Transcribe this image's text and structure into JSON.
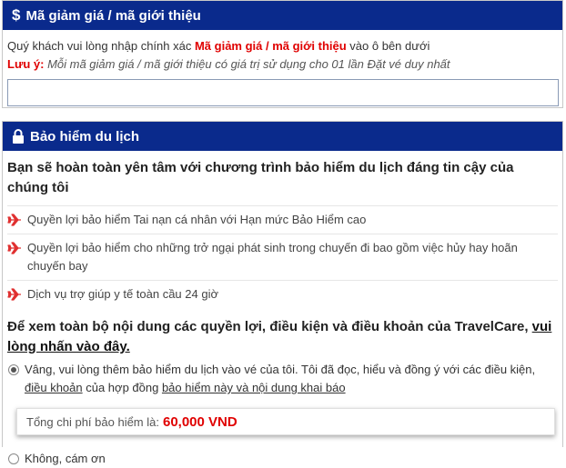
{
  "promo": {
    "title": "Mã giảm giá / mã giới thiệu",
    "icon": "dollar-icon",
    "instruction_prefix": "Quý khách vui lòng nhập chính xác ",
    "instruction_highlight": "Mã giảm giá / mã giới thiệu",
    "instruction_suffix": " vào ô bên dưới",
    "note_label": "Lưu ý:",
    "note_text": " Mỗi mã giảm giá / mã giới thiệu có giá trị sử dụng cho 01 lần Đặt vé duy nhất",
    "input_value": "",
    "input_placeholder": ""
  },
  "insurance": {
    "title": "Bảo hiểm du lịch",
    "icon": "lock-icon",
    "headline": "Bạn sẽ hoàn toàn yên tâm với chương trình bảo hiểm du lịch đáng tin cậy của chúng tôi",
    "benefits": [
      "Quyền lợi bảo hiểm Tai nạn cá nhân với Hạn mức Bảo Hiểm cao",
      "Quyền lợi bảo hiểm cho những trở ngại phát sinh trong chuyến đi bao gồm việc hủy hay hoãn chuyến bay",
      "Dịch vụ trợ giúp y tế toàn cầu 24 giờ"
    ],
    "terms_prefix": "Để xem toàn bộ nội dung các quyền lợi, điều kiện và điều khoản của TravelCare, ",
    "terms_link": "vui lòng nhấn vào đây.",
    "yes_text_1": "Vâng, vui lòng thêm bảo hiểm du lịch vào vé của tôi. Tôi đã đọc, hiểu và đồng ý với các điều kiện, ",
    "yes_link_1": "điều khoản",
    "yes_text_2": " của hợp đồng ",
    "yes_link_2": "bảo hiểm này và nội dung khai báo",
    "total_label": "Tổng chi phí bảo hiểm là:",
    "total_amount": "60,000 VND",
    "no_text": "Không, cám ơn",
    "accent_color": "#0a2a8c",
    "highlight_color": "#e00000"
  }
}
